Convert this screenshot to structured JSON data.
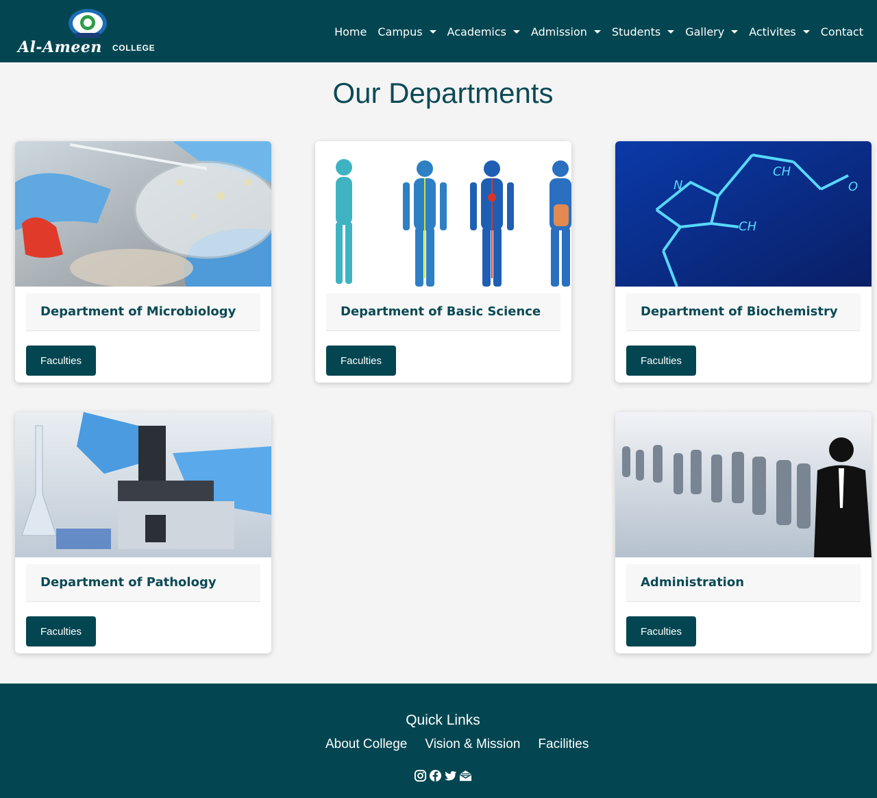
{
  "brand": {
    "name": "Al-Ameen",
    "suffix": "COLLEGE"
  },
  "nav": {
    "items": [
      {
        "label": "Home",
        "dropdown": false
      },
      {
        "label": "Campus",
        "dropdown": true
      },
      {
        "label": "Academics",
        "dropdown": true
      },
      {
        "label": "Admission",
        "dropdown": true
      },
      {
        "label": "Students",
        "dropdown": true
      },
      {
        "label": "Gallery",
        "dropdown": true
      },
      {
        "label": "Activites",
        "dropdown": true
      },
      {
        "label": "Contact",
        "dropdown": false
      }
    ]
  },
  "main": {
    "title": "Our Departments",
    "departments": [
      {
        "title": "Department of Microbiology",
        "button": "Faculties",
        "image": "petri-dish-photo"
      },
      {
        "title": "Department of Basic Science",
        "button": "Faculties",
        "image": "human-anatomy-photo"
      },
      {
        "title": "Department of Biochemistry",
        "button": "Faculties",
        "image": "molecule-photo"
      },
      {
        "title": "Department of Pathology",
        "button": "Faculties",
        "image": "microscope-photo"
      },
      {
        "title": "Administration",
        "button": "Faculties",
        "image": "business-people-photo"
      }
    ]
  },
  "footer": {
    "title": "Quick Links",
    "links": [
      "About College",
      "Vision & Mission",
      "Facilities"
    ],
    "socials": [
      "instagram-icon",
      "facebook-icon",
      "twitter-icon",
      "email-icon"
    ]
  },
  "colors": {
    "primary": "#034651",
    "heading": "#0b4a55",
    "background": "#f4f4f4"
  }
}
